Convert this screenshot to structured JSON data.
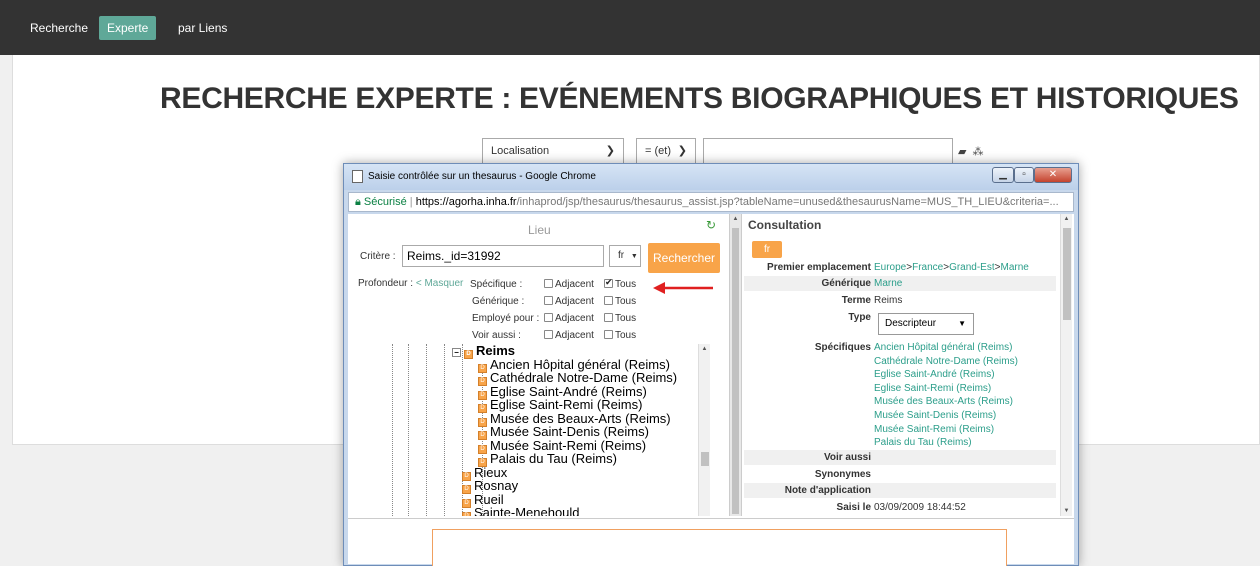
{
  "nav": {
    "items": [
      {
        "label": "Recherche",
        "active": false
      },
      {
        "label": "Experte",
        "active": true
      },
      {
        "label": "par Liens",
        "active": false
      }
    ]
  },
  "page": {
    "title": "RECHERCHE EXPERTE : EVÉNEMENTS BIOGRAPHIQUES ET HISTORIQUES",
    "field_select": "Localisation",
    "operator_select": "= (et)",
    "value_input": ""
  },
  "popup": {
    "window_title": "Saisie contrôlée sur un thesaurus - Google Chrome",
    "url_secure_label": "Sécurisé",
    "url_host": "https://agorha.inha.fr",
    "url_path": "/inhaprod/jsp/thesaurus/thesaurus_assist.jsp?tableName=unused&thesaurusName=MUS_TH_LIEU&criteria=...",
    "left": {
      "title": "Lieu",
      "critere_label": "Critère :",
      "critere_value": "Reims._id=31992",
      "lang": "fr",
      "search_button": "Rechercher",
      "profondeur_label": "Profondeur :",
      "masquer_label": "< Masquer",
      "depth_rows": [
        {
          "label": "Spécifique :",
          "adjacent": false,
          "tous": true
        },
        {
          "label": "Générique :",
          "adjacent": false,
          "tous": false
        },
        {
          "label": "Employé pour :",
          "adjacent": false,
          "tous": false
        },
        {
          "label": "Voir aussi :",
          "adjacent": false,
          "tous": false
        }
      ],
      "adjacent_label": "Adjacent",
      "tous_label": "Tous",
      "tree": {
        "root": "Reims",
        "children": [
          "Ancien Hôpital général (Reims)",
          "Cathédrale Notre-Dame (Reims)",
          "Eglise Saint-André (Reims)",
          "Eglise Saint-Remi (Reims)",
          "Musée des Beaux-Arts (Reims)",
          "Musée Saint-Denis (Reims)",
          "Musée Saint-Remi (Reims)",
          "Palais du Tau (Reims)"
        ],
        "siblings": [
          "Rieux",
          "Rosnay",
          "Rueil",
          "Sainte-Menehould"
        ]
      }
    },
    "right": {
      "title": "Consultation",
      "lang_tab": "fr",
      "premier_label": "Premier emplacement",
      "premier_path": [
        "Europe",
        "France",
        "Grand-Est",
        "Marne"
      ],
      "generique_label": "Générique",
      "generique_value": "Marne",
      "terme_label": "Terme",
      "terme_value": "Reims",
      "type_label": "Type",
      "type_value": "Descripteur",
      "specifiques_label": "Spécifiques",
      "specifiques": [
        "Ancien Hôpital général (Reims)",
        "Cathédrale Notre-Dame (Reims)",
        "Eglise Saint-André (Reims)",
        "Eglise Saint-Remi (Reims)",
        "Musée des Beaux-Arts (Reims)",
        "Musée Saint-Denis (Reims)",
        "Musée Saint-Remi (Reims)",
        "Palais du Tau (Reims)"
      ],
      "voir_aussi_label": "Voir aussi",
      "synonymes_label": "Synonymes",
      "note_label": "Note d'application",
      "saisi_label": "Saisi le",
      "saisi_value": "03/09/2009 18:44:52"
    }
  },
  "colors": {
    "accent": "#5fa898",
    "orange": "#f8a449",
    "link": "#2b9e8a",
    "nav_bg": "#333333"
  }
}
